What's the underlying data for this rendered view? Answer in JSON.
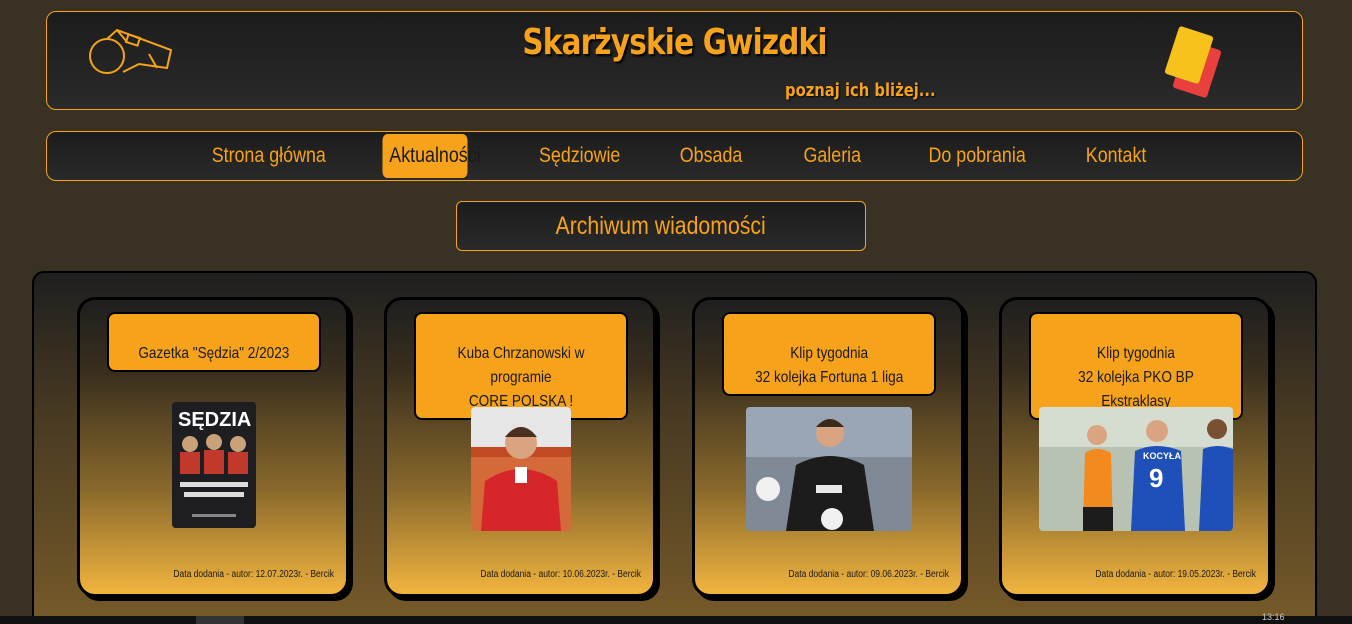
{
  "header": {
    "title": "Skarżyskie Gwizdki",
    "subtitle": "poznaj ich bliżej...",
    "left_icon": "whistle-icon",
    "right_icon": "referee-cards-icon"
  },
  "nav": {
    "items": [
      {
        "label": "Strona główna"
      },
      {
        "label": "Aktualności",
        "active": true
      },
      {
        "label": "Sędziowie"
      },
      {
        "label": "Obsada"
      },
      {
        "label": "Galeria"
      },
      {
        "label": "Do pobrania"
      },
      {
        "label": "Kontakt"
      }
    ]
  },
  "section": {
    "title": "Archiwum wiadomości"
  },
  "news": [
    {
      "title": "Gazetka \"Sędzia\" 2/2023",
      "meta": "Data dodania - autor: 12.07.2023r. - Bercik",
      "image": "magazine-cover",
      "image_text": "SĘDZIA"
    },
    {
      "title": "Kuba Chrzanowski w programie\nCORE POLSKA !",
      "meta": "Data dodania - autor: 10.06.2023r. - Bercik",
      "image": "person-photo"
    },
    {
      "title": "Klip tygodnia\n32 kolejka Fortuna 1 liga",
      "meta": "Data dodania - autor: 09.06.2023r. - Bercik",
      "image": "goalkeeper-photo"
    },
    {
      "title": "Klip tygodnia\n32 kolejka PKO BP Ekstraklasy",
      "meta": "Data dodania - autor: 19.05.2023r. - Bercik",
      "image": "referee-photo",
      "image_text": "KOCYŁA"
    }
  ],
  "taskbar": {
    "clock": "13:16"
  },
  "colors": {
    "accent": "#f7a21b",
    "background": "#3a3125",
    "panel": "#1c1c1c"
  }
}
